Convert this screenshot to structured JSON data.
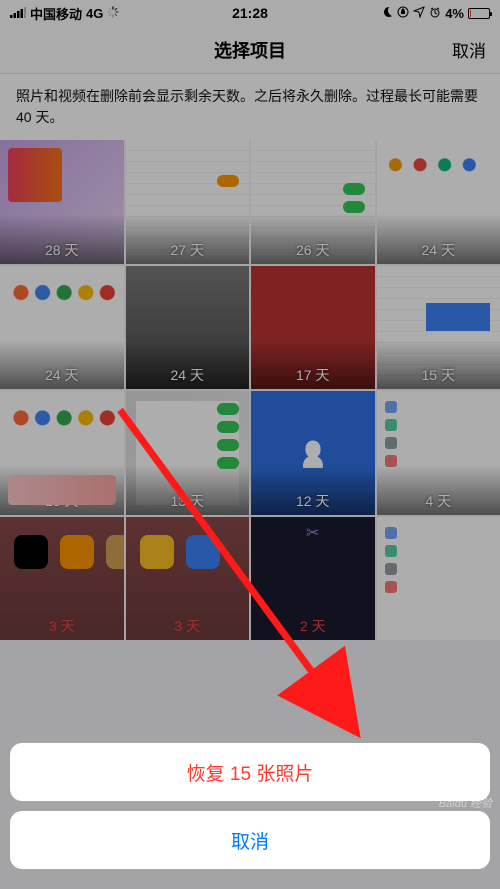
{
  "status": {
    "carrier": "中国移动",
    "network": "4G",
    "time": "21:28",
    "battery_pct": "4%"
  },
  "nav": {
    "title": "选择项目",
    "cancel": "取消"
  },
  "info": "照片和视频在删除前会显示剩余天数。之后将永久删除。过程最长可能需要 40 天。",
  "grid": {
    "items": [
      {
        "days": "28 天"
      },
      {
        "days": "27 天"
      },
      {
        "days": "26 天"
      },
      {
        "days": "24 天"
      },
      {
        "days": "24 天"
      },
      {
        "days": "24 天"
      },
      {
        "days": "17 天"
      },
      {
        "days": "15 天"
      },
      {
        "days": "13 天"
      },
      {
        "days": "13 天"
      },
      {
        "days": "12 天"
      },
      {
        "days": "4 天"
      },
      {
        "days": "3 天"
      },
      {
        "days": "3 天"
      },
      {
        "days": "2 天"
      },
      {
        "days": ""
      }
    ]
  },
  "sheet": {
    "recover": "恢复 15 张照片",
    "cancel": "取消"
  },
  "watermark": "Baidu 经验"
}
